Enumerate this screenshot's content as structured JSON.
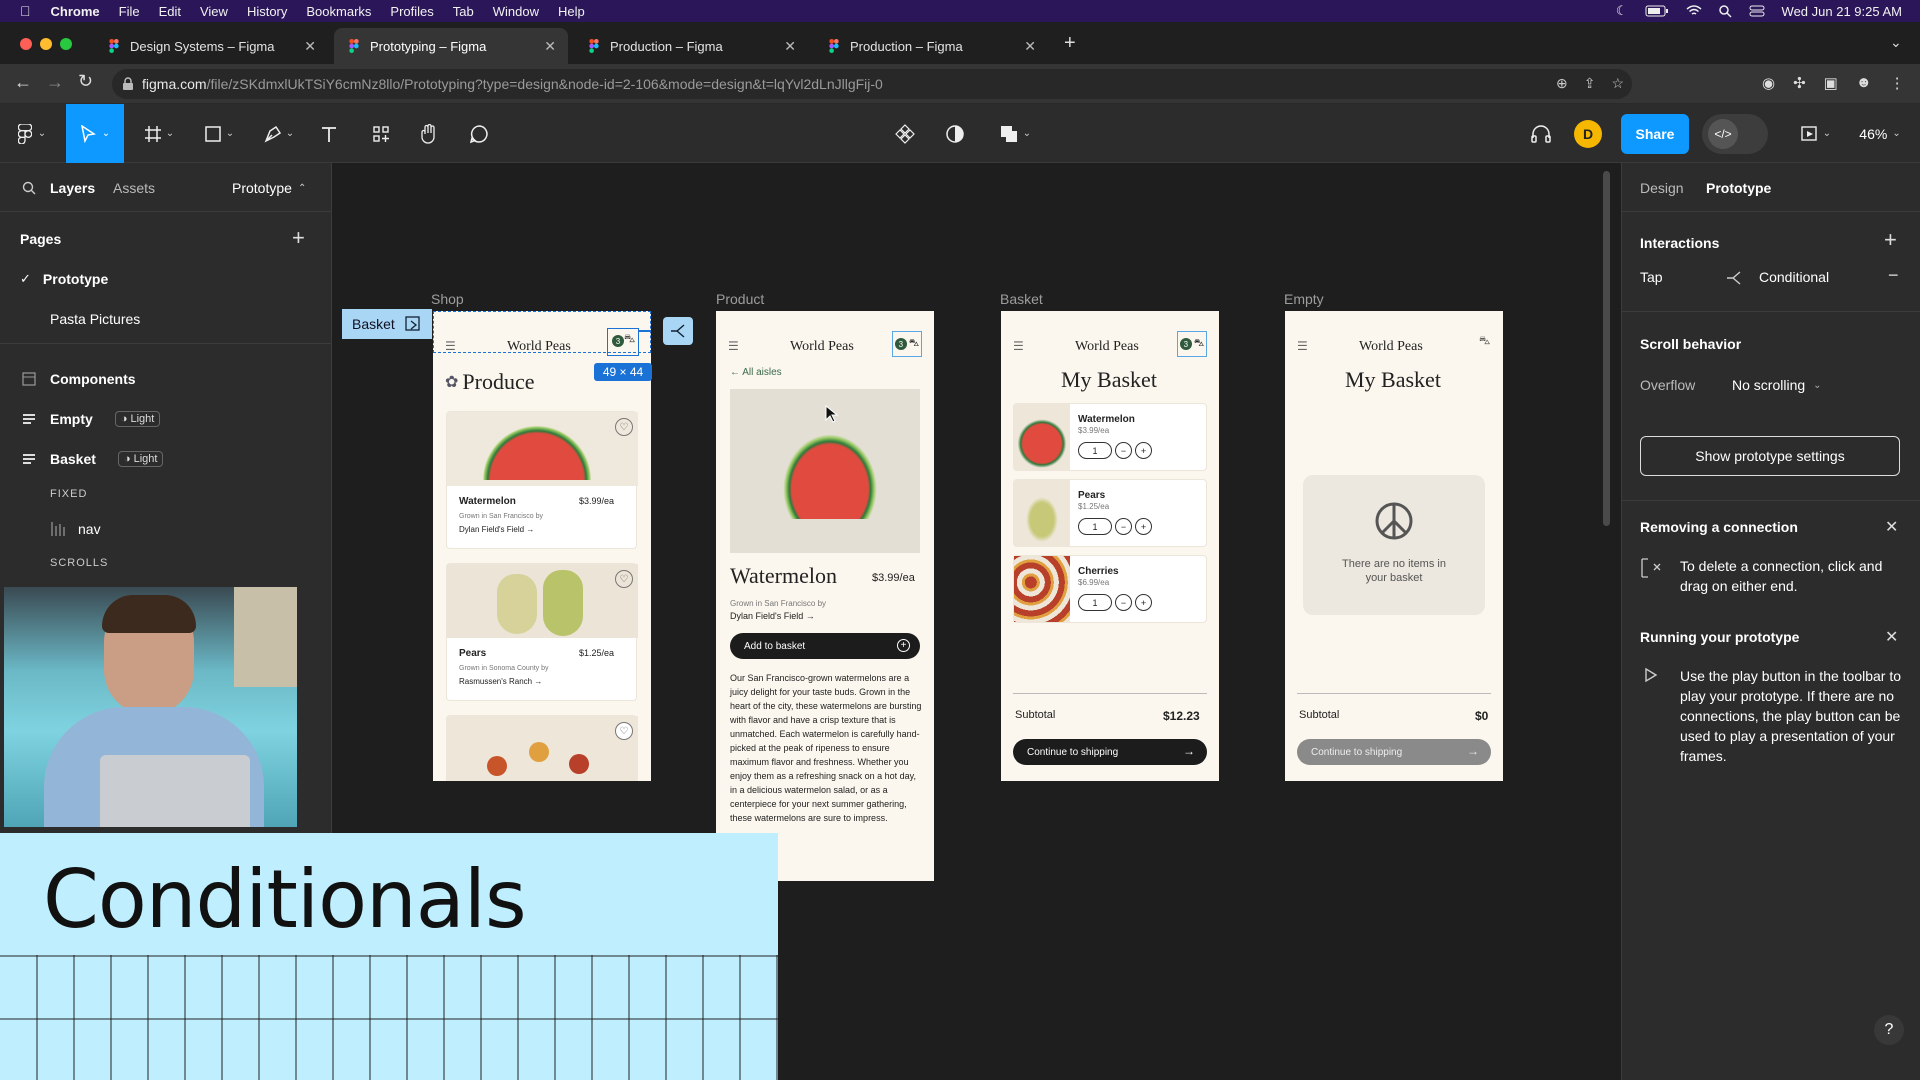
{
  "menubar": {
    "app": "Chrome",
    "items": [
      "File",
      "Edit",
      "View",
      "History",
      "Bookmarks",
      "Profiles",
      "Tab",
      "Window",
      "Help"
    ],
    "datetime": "Wed Jun 21  9:25 AM"
  },
  "tabs": [
    {
      "title": "Design Systems – Figma"
    },
    {
      "title": "Prototyping – Figma"
    },
    {
      "title": "Production – Figma"
    },
    {
      "title": "Production – Figma"
    }
  ],
  "url": {
    "domain": "figma.com",
    "path": "/file/zSKdmxlUkTSiY6cmNz8llo/Prototyping?type=design&node-id=2-106&mode=design&t=lqYvl2dLnJllgFij-0"
  },
  "toolbar": {
    "user_initial": "D",
    "share_label": "Share",
    "zoom": "46%"
  },
  "left_panel": {
    "tabs": {
      "layers": "Layers",
      "assets": "Assets",
      "page_switch": "Prototype"
    },
    "pages_title": "Pages",
    "pages": [
      "Prototype",
      "Pasta Pictures"
    ],
    "layers": {
      "components": "Components",
      "empty": "Empty",
      "basket": "Basket",
      "light": "Light",
      "fixed": "FIXED",
      "nav": "nav",
      "scrolls": "SCROLLS"
    }
  },
  "canvas": {
    "frame_labels": {
      "shop": "Shop",
      "product": "Product",
      "basket": "Basket",
      "empty": "Empty"
    },
    "basket_tag": "Basket",
    "selection_size": "49 × 44",
    "brand": "World Peas",
    "shop": {
      "heading": "Produce",
      "items": [
        {
          "name": "Watermelon",
          "price": "$3.99/ea",
          "origin": "Grown in San Francisco by",
          "farm": "Dylan Field's Field →"
        },
        {
          "name": "Pears",
          "price": "$1.25/ea",
          "origin": "Grown in Sonoma County by",
          "farm": "Rasmussen's Ranch →"
        }
      ],
      "badge": "3"
    },
    "product": {
      "back": "← All aisles",
      "name": "Watermelon",
      "price": "$3.99/ea",
      "origin": "Grown in San Francisco by",
      "farm": "Dylan Field's Field →",
      "add_button": "Add to basket",
      "description": "Our San Francisco-grown watermelons are a juicy delight for your taste buds. Grown in the heart of the city, these watermelons are bursting with flavor and have a crisp texture that is unmatched. Each watermelon is carefully hand-picked at the peak of ripeness to ensure maximum flavor and freshness. Whether you enjoy them as a refreshing snack on a hot day, in a delicious watermelon salad, or as a centerpiece for your next summer gathering, these watermelons are sure to impress.",
      "badge": "3"
    },
    "basket": {
      "title": "My Basket",
      "items": [
        {
          "name": "Watermelon",
          "price": "$3.99/ea",
          "qty": "1"
        },
        {
          "name": "Pears",
          "price": "$1.25/ea",
          "qty": "1"
        },
        {
          "name": "Cherries",
          "price": "$6.99/ea",
          "qty": "1"
        }
      ],
      "subtotal_label": "Subtotal",
      "subtotal": "$12.23",
      "cta": "Continue to shipping",
      "badge": "3"
    },
    "empty": {
      "title": "My Basket",
      "message": "There are no items in your basket",
      "subtotal_label": "Subtotal",
      "subtotal": "$0",
      "cta": "Continue to shipping"
    }
  },
  "right_panel": {
    "tabs": {
      "design": "Design",
      "prototype": "Prototype"
    },
    "interactions_title": "Interactions",
    "trigger": "Tap",
    "action": "Conditional",
    "scroll_title": "Scroll behavior",
    "overflow_label": "Overflow",
    "overflow_value": "No scrolling",
    "settings_button": "Show prototype settings",
    "tip1": {
      "title": "Removing a connection",
      "body": "To delete a connection, click and drag on either end."
    },
    "tip2": {
      "title": "Running your prototype",
      "body": "Use the play button in the toolbar to play your prototype. If there are no connections, the play button can be used to play a presentation of your frames."
    },
    "help": "?"
  },
  "overlay": {
    "title": "Conditionals"
  },
  "colors": {
    "figma_blue": "#0d99ff",
    "accent_blue": "#1a72d6",
    "menubar": "#2a1658",
    "overlay": "#bfeefe",
    "cream": "#fbf7ee"
  }
}
